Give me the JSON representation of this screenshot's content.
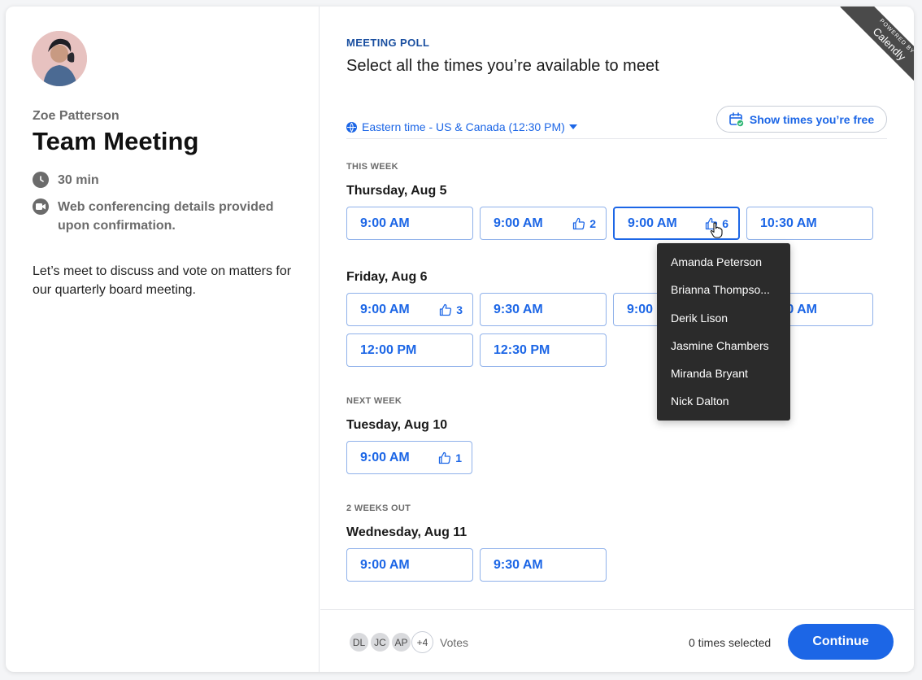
{
  "host": {
    "name": "Zoe Patterson",
    "event_title": "Team Meeting",
    "duration": "30 min",
    "conferencing": "Web conferencing details provided upon confirmation.",
    "description": "Let’s meet to discuss and vote on matters for our quarterly board meeting."
  },
  "poll": {
    "label": "MEETING POLL",
    "heading": "Select all the times you’re available to meet",
    "timezone": "Eastern time - US & Canada (12:30 PM)",
    "free_button": "Show times you’re free"
  },
  "ribbon": {
    "powered": "POWERED BY",
    "brand": "Calendly"
  },
  "weeks": [
    {
      "label": "THIS WEEK",
      "days": [
        {
          "label": "Thursday, Aug 5",
          "slots": [
            {
              "time": "9:00 AM",
              "votes": ""
            },
            {
              "time": "9:00 AM",
              "votes": "2"
            },
            {
              "time": "9:00 AM",
              "votes": "6"
            },
            {
              "time": "10:30 AM",
              "votes": ""
            }
          ]
        },
        {
          "label": "Friday, Aug 6",
          "slots": [
            {
              "time": "9:00 AM",
              "votes": "3"
            },
            {
              "time": "9:30 AM",
              "votes": ""
            },
            {
              "time": "9:00",
              "votes": ""
            },
            {
              "time": "0 AM",
              "votes": ""
            },
            {
              "time": "12:00 PM",
              "votes": ""
            },
            {
              "time": "12:30 PM",
              "votes": ""
            }
          ]
        }
      ]
    },
    {
      "label": "NEXT WEEK",
      "days": [
        {
          "label": "Tuesday, Aug 10",
          "slots": [
            {
              "time": "9:00 AM",
              "votes": "1"
            }
          ]
        }
      ]
    },
    {
      "label": "2 WEEKS OUT",
      "days": [
        {
          "label": "Wednesday, Aug 11",
          "slots": [
            {
              "time": "9:00 AM",
              "votes": ""
            },
            {
              "time": "9:30 AM",
              "votes": ""
            }
          ]
        }
      ]
    }
  ],
  "tooltip": {
    "voters": [
      "Amanda Peterson",
      "Brianna Thompso...",
      "Derik Lison",
      "Jasmine Chambers",
      "Miranda Bryant",
      "Nick Dalton"
    ]
  },
  "footer": {
    "voter_initials": [
      "DL",
      "JC",
      "AP",
      "+4"
    ],
    "votes_label": "Votes",
    "selected_count": "0 times selected",
    "continue_label": "Continue"
  },
  "colors": {
    "accent": "#1c66e6",
    "heading_blue": "#1a4fa0",
    "tooltip_bg": "#2b2b2b"
  },
  "icons": [
    "clock-icon",
    "video-icon",
    "globe-icon",
    "calendar-check-icon",
    "thumbs-up-icon",
    "pointer-hand-icon"
  ]
}
